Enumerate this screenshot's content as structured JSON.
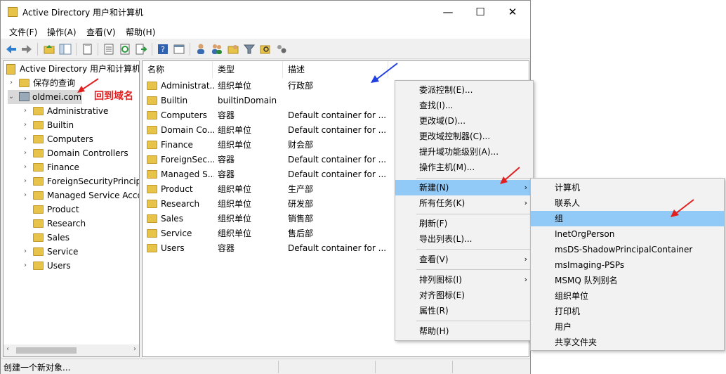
{
  "window": {
    "title": "Active Directory 用户和计算机",
    "min_glyph": "—",
    "max_glyph": "☐",
    "close_glyph": "✕"
  },
  "menubar": [
    "文件(F)",
    "操作(A)",
    "查看(V)",
    "帮助(H)"
  ],
  "toolbar_icons": [
    "back-arrow-icon",
    "forward-arrow-icon",
    "up-folder-icon",
    "show-hide-tree-icon",
    "properties-icon",
    "export-list-icon",
    "refresh-icon",
    "export-icon",
    "help-icon",
    "view-icon",
    "new-user-icon",
    "new-group-icon",
    "new-ou-icon",
    "filter-icon",
    "find-icon",
    "delegate-icon"
  ],
  "tree": {
    "root": "Active Directory 用户和计算机",
    "saved_queries": "保存的查询",
    "domain": "oldmei.com",
    "children": [
      "Administrative",
      "Builtin",
      "Computers",
      "Domain Controllers",
      "Finance",
      "ForeignSecurityPrincipals",
      "Managed Service Accounts",
      "Product",
      "Research",
      "Sales",
      "Service",
      "Users"
    ]
  },
  "annotation": "回到域名",
  "list": {
    "columns": [
      "名称",
      "类型",
      "描述"
    ],
    "rows": [
      {
        "name": "Administrat...",
        "type": "组织单位",
        "desc": "行政部"
      },
      {
        "name": "Builtin",
        "type": "builtinDomain",
        "desc": ""
      },
      {
        "name": "Computers",
        "type": "容器",
        "desc": "Default container for ..."
      },
      {
        "name": "Domain Co...",
        "type": "组织单位",
        "desc": "Default container for ..."
      },
      {
        "name": "Finance",
        "type": "组织单位",
        "desc": "财会部"
      },
      {
        "name": "ForeignSec...",
        "type": "容器",
        "desc": "Default container for ..."
      },
      {
        "name": "Managed S...",
        "type": "容器",
        "desc": "Default container for ..."
      },
      {
        "name": "Product",
        "type": "组织单位",
        "desc": "生产部"
      },
      {
        "name": "Research",
        "type": "组织单位",
        "desc": "研发部"
      },
      {
        "name": "Sales",
        "type": "组织单位",
        "desc": "销售部"
      },
      {
        "name": "Service",
        "type": "组织单位",
        "desc": "售后部"
      },
      {
        "name": "Users",
        "type": "容器",
        "desc": "Default container for ..."
      }
    ]
  },
  "context_menu": {
    "items": [
      "委派控制(E)...",
      "查找(I)...",
      "更改域(D)...",
      "更改域控制器(C)...",
      "提升域功能级别(A)...",
      "操作主机(M)...",
      "新建(N)",
      "所有任务(K)",
      "刷新(F)",
      "导出列表(L)...",
      "查看(V)",
      "排列图标(I)",
      "对齐图标(E)",
      "属性(R)",
      "帮助(H)"
    ]
  },
  "submenu": {
    "items": [
      "计算机",
      "联系人",
      "组",
      "InetOrgPerson",
      "msDS-ShadowPrincipalContainer",
      "msImaging-PSPs",
      "MSMQ 队列别名",
      "组织单位",
      "打印机",
      "用户",
      "共享文件夹"
    ]
  },
  "status": {
    "text": "创建一个新对象..."
  },
  "colors": {
    "highlight": "#91c9f7",
    "annotation": "#e02020",
    "arrow_red": "#e02020",
    "arrow_blue": "#2040e0",
    "folder": "#e8c34a"
  }
}
